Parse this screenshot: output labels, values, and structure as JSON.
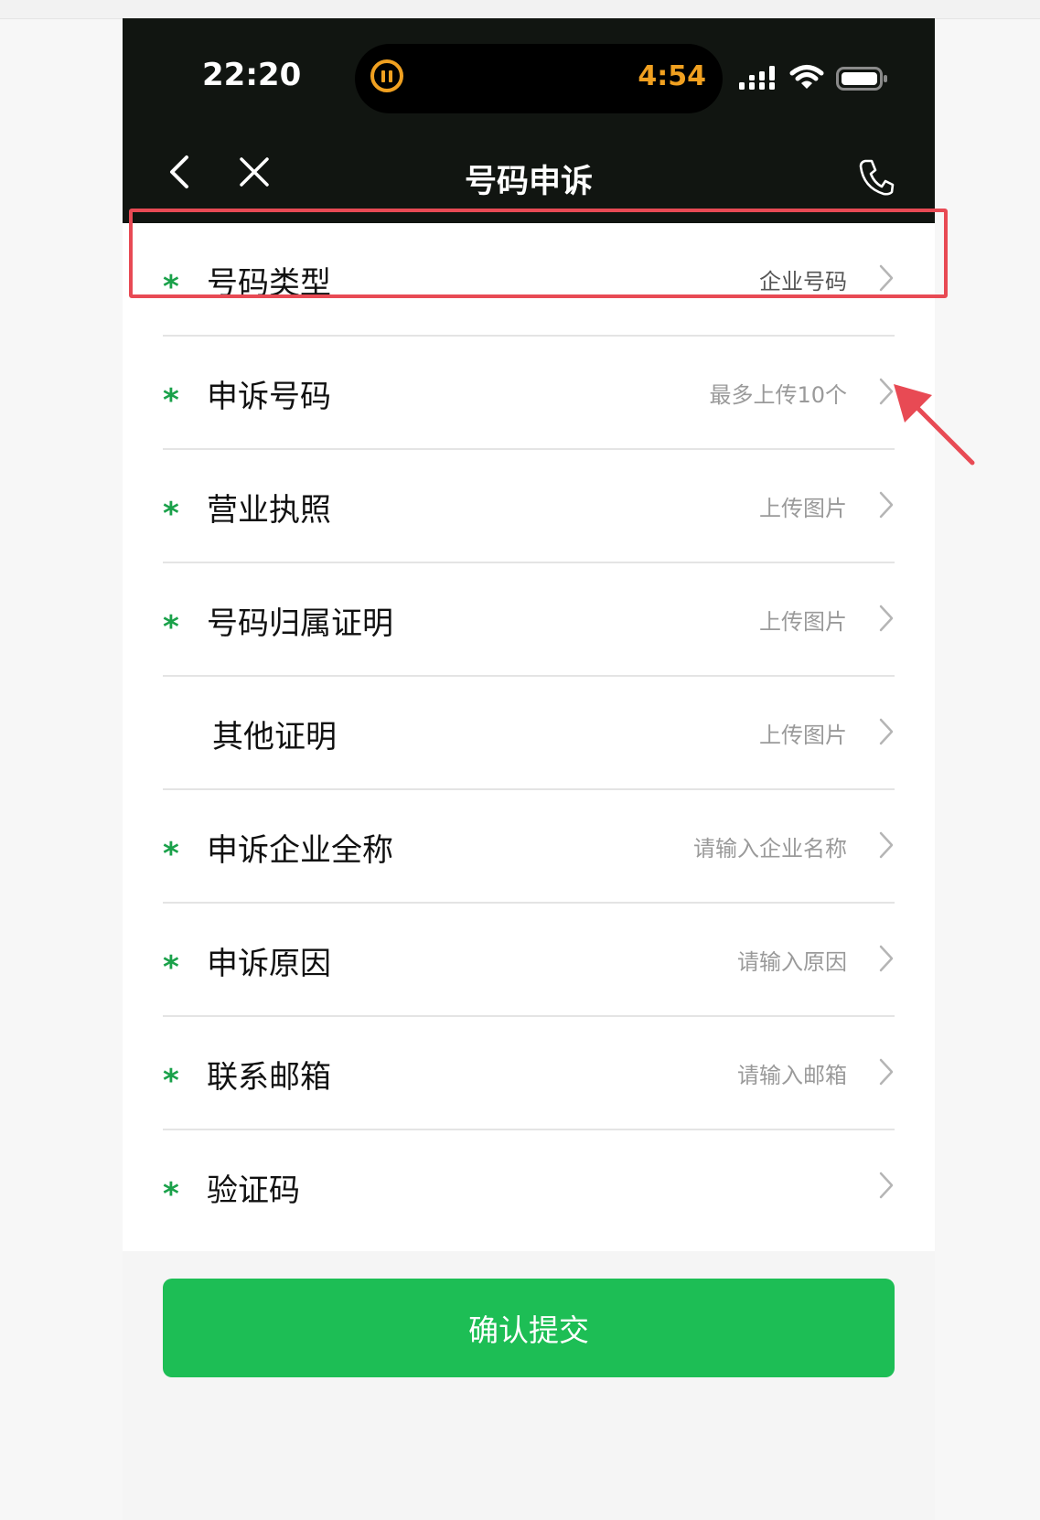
{
  "status": {
    "time": "22:20",
    "timer": "4:54"
  },
  "nav": {
    "title": "号码申诉"
  },
  "form": {
    "rows": [
      {
        "label": "号码类型",
        "value": "企业号码"
      },
      {
        "label": "申诉号码",
        "value": "最多上传10个"
      },
      {
        "label": "营业执照",
        "value": "上传图片"
      },
      {
        "label": "号码归属证明",
        "value": "上传图片"
      },
      {
        "label": "其他证明",
        "value": "上传图片"
      },
      {
        "label": "申诉企业全称",
        "value": "请输入企业名称"
      },
      {
        "label": "申诉原因",
        "value": "请输入原因"
      },
      {
        "label": "联系邮箱",
        "value": "请输入邮箱"
      },
      {
        "label": "验证码",
        "value": ""
      }
    ],
    "required_mark": "*"
  },
  "submit_label": "确认提交",
  "colors": {
    "accent_green": "#1dbe55",
    "required_green": "#1aa14a",
    "highlight_red": "#e84a54",
    "status_orange": "#f0a020"
  }
}
